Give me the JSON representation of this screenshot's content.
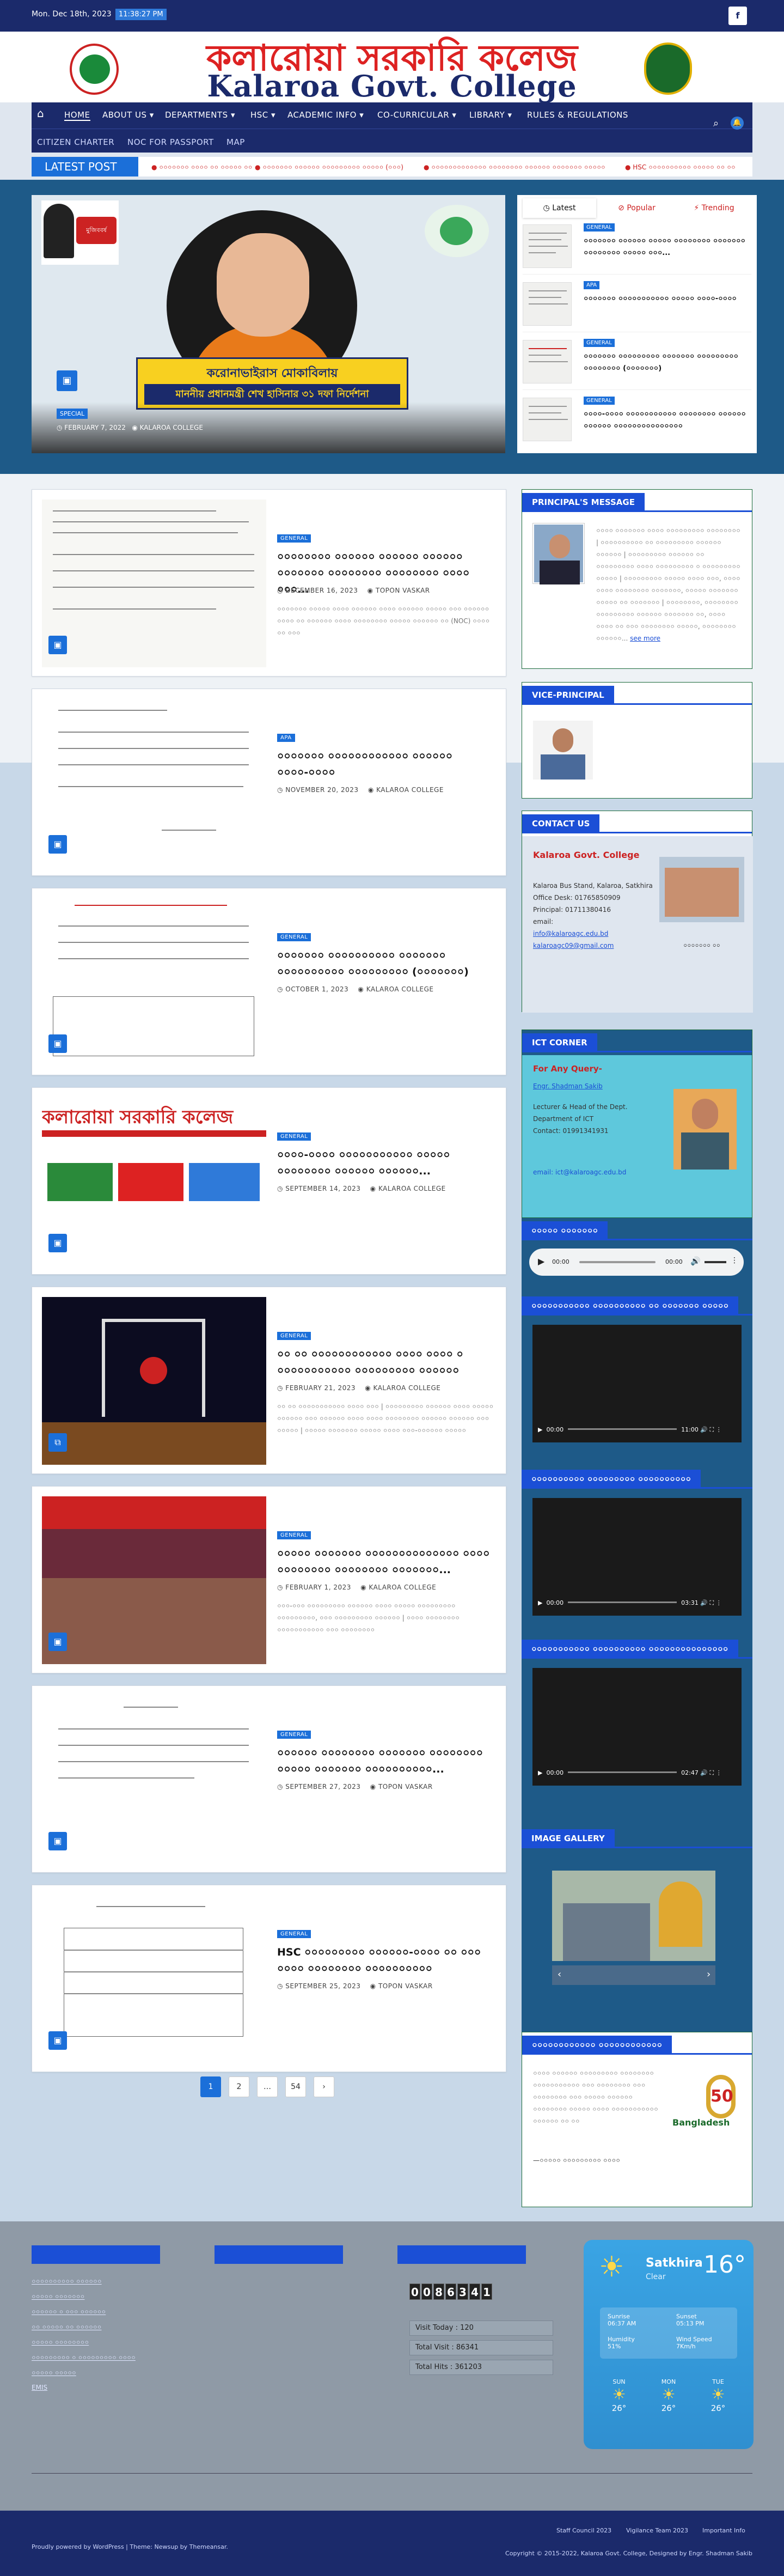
{
  "topbar": {
    "date": "Mon. Dec 18th, 2023",
    "time": "11:38:27 PM"
  },
  "header": {
    "title_bn": "কলারোয়া সরকারি কলেজ",
    "title_en": "Kalaroa Govt. College"
  },
  "nav": {
    "row1": [
      "HOME",
      "ABOUT US ▾",
      "DEPARTMENTS ▾",
      "HSC ▾",
      "ACADEMIC INFO ▾",
      "CO-CURRICULAR ▾",
      "LIBRARY ▾",
      "RULES & REGULATIONS"
    ],
    "row2": [
      "CITIZEN CHARTER",
      "NOC FOR PASSPORT",
      "MAP"
    ]
  },
  "ribbon": {
    "label": "LATEST POST",
    "items": [
      "● ০০০০০০০ ০০০০ ০০ ০০০০০ ০০",
      "● ০০০০০০০ ০০০০০০ ০০০০০০০০০ ০০০০০ (০০০)",
      "● ০০০০০০০০০০০০০ ০০০০০০০০ ০০০০০০ ০০০০০০০ ০০০০০",
      "● HSC ০০০০০০০০০০ ০০০০০ ০০ ০০"
    ]
  },
  "hero": {
    "caption_line1": "করোনাভাইরাস মোকাবিলায়",
    "caption_line2": "মাননীয় প্রধানমন্ত্রী শেখ হাসিনার ৩১ দফা নির্দেশনা",
    "badge": "SPECIAL",
    "date": "FEBRUARY 7, 2022",
    "author": "KALAROA COLLEGE",
    "mujib": "মুজিববর্ষ"
  },
  "tabs": {
    "labels": [
      "Latest",
      "Popular",
      "Trending"
    ],
    "posts": [
      {
        "cat": "GENERAL",
        "title": "০০০০০০০ ০০০০০০ ০০০০০ ০০০০০০০০ ০০০০০০০ ০০০০০০০০ ০০০০০ ০০০..."
      },
      {
        "cat": "APA",
        "title": "০০০০০০০ ০০০০০০০০০০০ ০০০০০ ০০০০-০০০০"
      },
      {
        "cat": "GENERAL",
        "title": "০০০০০০০ ০০০০০০০০০ ০০০০০০০ ০০০০০০০০০ ০০০০০০০০ (০০০০০০০)"
      },
      {
        "cat": "GENERAL",
        "title": "০০০০-০০০০ ০০০০০০০০০০০ ০০০০০০০০ ০০০০০০ ০০০০০০ ০০০০০০০০০০০০০০০"
      }
    ]
  },
  "posts": [
    {
      "cat": "GENERAL",
      "title": "০০০০০০০০ ০০০০০০ ০০০০০০ ০০০০০০ ০০০০০০০ ০০০০০০০০ ০০০০০০০০ ০০০০ ০০০...",
      "date": "DECEMBER 16, 2023",
      "author": "TOPON VASKAR",
      "excerpt": "০০০০০০০ ০০০০০ ০০০০ ০০০০০০ ০০০০ ০০০০০০ ০০০০০ ০০০ ০০০০০০ ০০০০ ০০ ০০০০০০ ০০০০ ০০০০০০০০ ০০০০০ ০০০০০০ ০০ (NOC) ০০০০ ০০ ০০০"
    },
    {
      "cat": "APA",
      "title": "০০০০০০০ ০০০০০০০০০০০০ ০০০০০০ ০০০০-০০০০",
      "date": "NOVEMBER 20, 2023",
      "author": "KALAROA COLLEGE",
      "excerpt": ""
    },
    {
      "cat": "GENERAL",
      "title": "০০০০০০০ ০০০০০০০০০০ ০০০০০০০ ০০০০০০০০০০ ০০০০০০০০০ (০০০০০০০)",
      "date": "OCTOBER 1, 2023",
      "author": "KALAROA COLLEGE",
      "excerpt": ""
    },
    {
      "cat": "GENERAL",
      "title": "০০০০-০০০০ ০০০০০০০০০০০ ০০০০০ ০০০০০০০০ ০০০০০০ ০০০০০০...",
      "date": "SEPTEMBER 14, 2023",
      "author": "KALAROA COLLEGE",
      "excerpt": ""
    },
    {
      "cat": "GENERAL",
      "title": "০০ ০০ ০০০০০০০০০০০০ ০০০০ ০০০০ ০ ০০০০০০০০০০০ ০০০০০০০০০ ০০০০০০",
      "date": "FEBRUARY 21, 2023",
      "author": "KALAROA COLLEGE",
      "excerpt": "০০ ০০ ০০০০০০০০০০০ ০০০০ ০০০ | ০০০০০০০০০ ০০০০০০ ০০০০ ০০০০০ ০০০০০০ ০০০ ০০০০০০ ০০০০ ০০০০ ০০০০০০০০ ০০০০০০ ০০০০০০ ০০০ ০০০০০ | ০০০০০ ০০০০০০০ ০০০০০ ০০০০ ০০০-০০০০০০ ০০০০০"
    },
    {
      "cat": "GENERAL",
      "title": "০০০০০ ০০০০০০০ ০০০০০০০০০০০০০০ ০০০০ ০০০০০০০০ ০০০০০০০০ ০০০০০০০...",
      "date": "FEBRUARY 1, 2023",
      "author": "KALAROA COLLEGE",
      "excerpt": "০০০-০০০ ০০০০০০০০০ ০০০০০০ ০০০০ ০০০০০ ০০০০০০০০০ ০০০০০০০০০, ০০০ ০০০০০০০০০ ০০০০০০ | ০০০০ ০০০০০০০০ ০০০০০০০০০০০ ০০০ ০০০০০০০০"
    },
    {
      "cat": "GENERAL",
      "title": "০০০০০০ ০০০০০০০০ ০০০০০০০ ০০০০০০০০ ০০০০০ ০০০০০০০ ০০০০০০০০০০...",
      "date": "SEPTEMBER 27, 2023",
      "author": "TOPON VASKAR",
      "excerpt": ""
    },
    {
      "cat": "GENERAL",
      "title": "HSC ০০০০০০০০০ ০০০০০০-০০০০ ০০ ০০০ ০০০০ ০০০০০০০০ ০০০০০০০০০০",
      "date": "SEPTEMBER 25, 2023",
      "author": "TOPON VASKAR",
      "excerpt": ""
    }
  ],
  "pagination": [
    "1",
    "2",
    "…",
    "54",
    "›"
  ],
  "sidebar": {
    "principal": {
      "heading": "PRINCIPAL'S MESSAGE",
      "text": "০০০০ ০০০০০০০ ০০০০ ০০০০০০০০০ ০০০০০০০০ | ০০০০০০০০০০ ০০ ০০০০০০০০০ ০০০০০০ ০০০০০০ | ০০০০০০০০০ ০০০০০০ ০০ ০০০০০০০০০ ০০০০ ০০০০০০০০০ ০ ০০০০০০০০০ ০০০০০ | ০০০০০০০০০ ০০০০০ ০০০০ ০০০, ০০০০ ০০০০ ০০০০০০০০ ০০০০০০০, ০০০০০ ০০০০০০০ ০০০০০ ০০ ০০০০০০০ | ০০০০০০০০, ০০০০০০০০ ০০০০০০০০০ ০০০০০০ ০০০০০০০ ০০, ০০০০ ০০০০ ০০ ০০০ ০০০০০০০০ ০০০০০, ০০০০০০০০ ০০০০০০...",
      "more": "see more"
    },
    "vice": {
      "heading": "VICE-PRINCIPAL"
    },
    "contact": {
      "heading": "CONTACT US",
      "name": "Kalaroa Govt. College",
      "addr": "Kalaroa Bus Stand, Kalaroa, Satkhira",
      "office": "Office Desk: 01765850909",
      "principal": "Principal: 01711380416",
      "email_label": "email:",
      "email1": "info@kalaroagc.edu.bd",
      "email2": "kalaroagc09@gmail.com",
      "img_caption": "০০০০০০০ ০০"
    },
    "ict": {
      "heading": "ICT CORNER",
      "query": "For Any Query-",
      "name": "Engr. Shadman Sakib",
      "role1": "Lecturer & Head of the Dept.",
      "role2": "Department of ICT",
      "contact": "Contact: 01991341931",
      "email": "email: ict@kalaroagc.edu.bd"
    },
    "audio": {
      "heading": "০০০০০ ০০০০০০০",
      "time": "00:00",
      "dur": "00:00"
    },
    "video1": {
      "heading": "০০০০০০০০০০০ ০০০০০০০০০০ ০০ ০০০০০০০ ০০০০০",
      "time": "00:00",
      "dur": "11:00"
    },
    "video2": {
      "heading": "০০০০০০০০০০ ০০০০০০০০০ ০০০০০০০০০০",
      "time": "00:00",
      "dur": "03:31"
    },
    "video3": {
      "heading": "০০০০০০০০০০০ ০০০০০০০০০০ ০০০০০০০০০০০০০০০",
      "time": "00:00",
      "dur": "02:47"
    },
    "gallery": {
      "heading": "IMAGE GALLERY"
    },
    "golden": {
      "heading": "০০০০০০০০০০০০ ০০০০০০০০০০০০",
      "text": "০০০০ ০০০০০০ ০০০০০০০০০ ০০০০০০০০ ০০০০০০০০০০০ ০০০ ০০০০০০০০ ০০০ ০০০০০০০০ ০০০ ০০০০০ ০০০০০০ ০০০০০০০০ ০০০০০ ০০০০ ০০০০০০০০০০০ ০০০০০০ ০০ ০০",
      "sig": "—০০০০০ ০০০০০০০০০ ০০০০",
      "logo_text": "Bangladesh",
      "logo_num": "50"
    }
  },
  "footer": {
    "links": [
      "০০০০০০০০০০ ০০০০০০",
      "০০০০০ ০০০০০০০",
      "০০০০০০ ০ ০০০ ০০০০০০",
      "০০ ০০০০০ ০০ ০০০০০০",
      "০০০০০ ০০০০০০০০",
      "০০০০০০০০০ ০ ০০০০০০০০০ ০০০০",
      "০০০০০ ০০০০০",
      "EMIS"
    ],
    "counter_digits": [
      "0",
      "0",
      "8",
      "6",
      "3",
      "4",
      "1"
    ],
    "visit_today": "Visit Today : 120",
    "total_visit": "Total Visit : 86341",
    "total_hits": "Total Hits : 361203",
    "weather": {
      "city": "Satkhira",
      "cond": "Clear",
      "temp": "16°",
      "sunrise_l": "Sunrise",
      "sunrise": "06:37 AM",
      "sunset_l": "Sunset",
      "sunset": "05:13 PM",
      "hum_l": "Humidity",
      "hum": "51%",
      "wind_l": "Wind Speed",
      "wind": "7Km/h",
      "days": [
        {
          "d": "SUN",
          "t": "26°"
        },
        {
          "d": "MON",
          "t": "26°"
        },
        {
          "d": "TUE",
          "t": "26°"
        }
      ]
    },
    "bottom_left": "Proudly powered by WordPress | Theme: Newsup by Themeansar.",
    "bottom_links": [
      "Staff Council 2023",
      "Vigilance Team 2023",
      "Important Info"
    ],
    "copyright": "Copyright © 2015-2022, Kalaroa Govt. College, Designed by Engr. Shadman Sakib"
  },
  "colors": {
    "navy": "#1b2a6b",
    "blue": "#1b6fd9",
    "red": "#d22222",
    "teal": "#1e5a88"
  }
}
